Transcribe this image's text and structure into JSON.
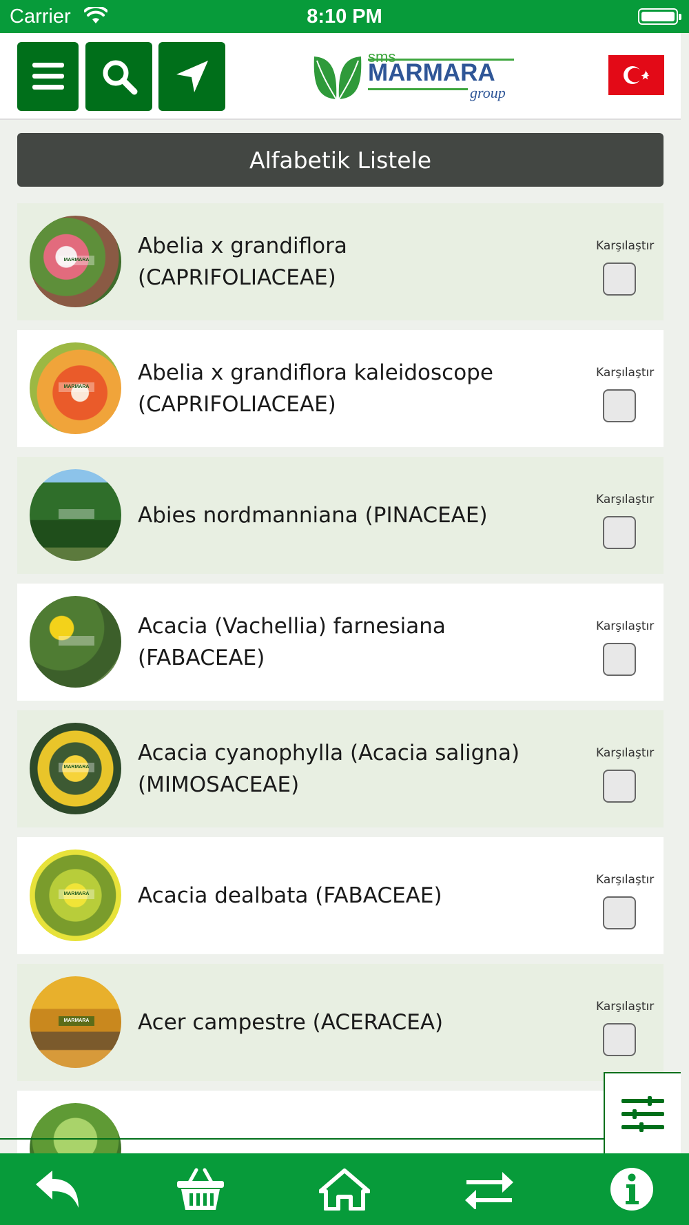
{
  "status_bar": {
    "carrier": "Carrier",
    "time": "8:10 PM"
  },
  "header": {
    "logo": {
      "line1": "sms",
      "line2": "MARMARA",
      "line3": "group"
    },
    "icons": [
      "menu-icon",
      "search-icon",
      "location-arrow-icon",
      "turkey-flag-icon"
    ]
  },
  "sort_bar": {
    "label": "Alfabetik Listele"
  },
  "list": {
    "compare_label": "Karşılaştır",
    "items": [
      {
        "name": "Abelia x grandiflora (CAPRIFOLIACEAE)"
      },
      {
        "name": "Abelia x grandiflora kaleidoscope (CAPRIFOLIACEAE)"
      },
      {
        "name": "Abies nordmanniana (PINACEAE)"
      },
      {
        "name": "Acacia (Vachellia) farnesiana (FABACEAE)"
      },
      {
        "name": "Acacia cyanophylla (Acacia saligna) (MIMOSACEAE)"
      },
      {
        "name": "Acacia dealbata (FABACEAE)"
      },
      {
        "name": "Acer campestre (ACERACEA)"
      },
      {
        "name": ""
      }
    ]
  },
  "tab_bar": {
    "icons": [
      "back-icon",
      "basket-icon",
      "home-icon",
      "compare-arrows-icon",
      "info-icon"
    ]
  },
  "colors": {
    "primary_green": "#079b3a",
    "dark_green": "#006f1a",
    "sort_bar_bg": "#434743",
    "row_tint": "#e8efe2"
  }
}
